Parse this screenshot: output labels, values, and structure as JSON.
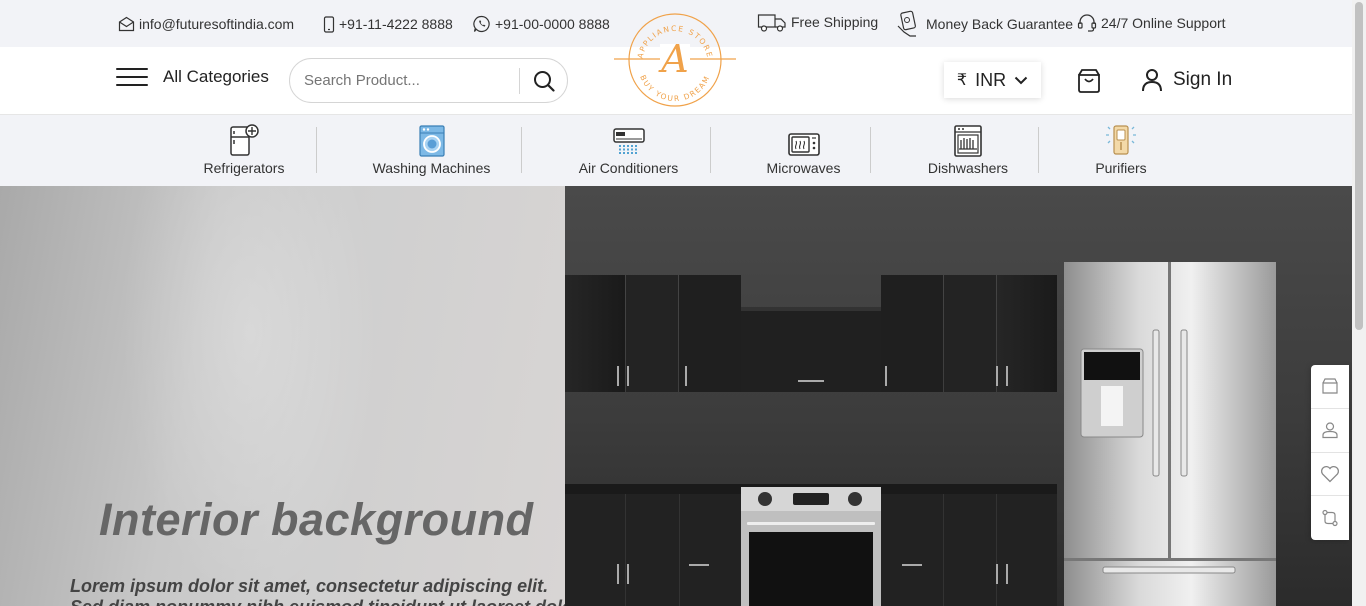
{
  "topbar": {
    "email": "info@futuresoftindia.com",
    "phone": "+91-11-4222 8888",
    "whatsapp": "+91-00-0000 8888",
    "free_shipping": "Free Shipping",
    "money_back": "Money Back Guarantee",
    "support": "24/7 Online Support"
  },
  "header": {
    "all_categories": "All Categories",
    "search_placeholder": "Search Product...",
    "logo": {
      "letter": "A",
      "top_text": "APPLIANCE STORE",
      "bottom_text": "BUY YOUR DREAM"
    },
    "currency": {
      "symbol": "₹",
      "code": "INR"
    },
    "sign_in": "Sign In"
  },
  "categories": [
    {
      "label": "Refrigerators",
      "icon": "refrigerator-icon"
    },
    {
      "label": "Washing Machines",
      "icon": "washing-machine-icon"
    },
    {
      "label": "Air Conditioners",
      "icon": "air-conditioner-icon"
    },
    {
      "label": "Microwaves",
      "icon": "microwave-icon"
    },
    {
      "label": "Dishwashers",
      "icon": "dishwasher-icon"
    },
    {
      "label": "Purifiers",
      "icon": "purifier-icon"
    }
  ],
  "hero": {
    "title": "Interior background",
    "subtitle": "Lorem ipsum dolor sit amet, consectetur adipiscing elit.",
    "subtitle2": "Sed diam nonummy nibh euismod tincidunt ut laoreet dolore."
  },
  "float_actions": [
    "cart-icon",
    "user-icon",
    "heart-icon",
    "compare-icon"
  ],
  "colors": {
    "brand_orange": "#f0a24a",
    "topbar_bg": "#f2f3f7"
  }
}
